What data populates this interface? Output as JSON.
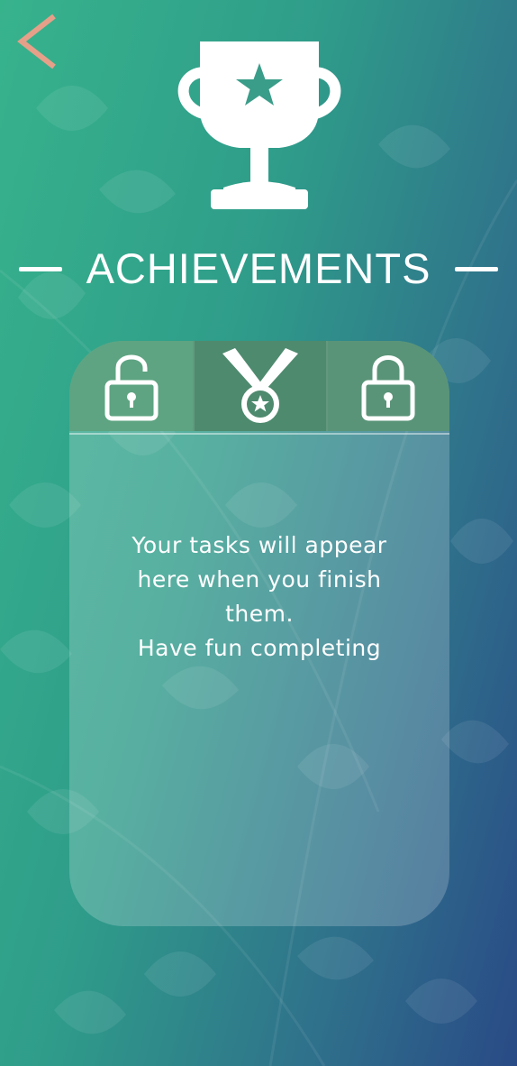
{
  "header": {
    "back_icon": "chevron-left-icon",
    "back_color": "#e6a089",
    "trophy_icon": "trophy-star-icon"
  },
  "title": {
    "text": "ACHIEVEMENTS"
  },
  "tabs": [
    {
      "id": "unlocked",
      "icon": "unlocked-padlock-icon",
      "selected": false
    },
    {
      "id": "medal",
      "icon": "medal-icon",
      "selected": true
    },
    {
      "id": "locked",
      "icon": "locked-padlock-icon",
      "selected": false
    }
  ],
  "empty_state": {
    "lines": [
      "Your tasks will appear",
      "here when you finish",
      "them.",
      "Have fun completing"
    ]
  },
  "colors": {
    "background_start": "#37b38c",
    "background_end": "#294a86",
    "tab_unlocked": "#5ea482",
    "tab_selected": "#4e8a6e",
    "tab_locked": "#5a9478",
    "text": "#ffffff"
  }
}
